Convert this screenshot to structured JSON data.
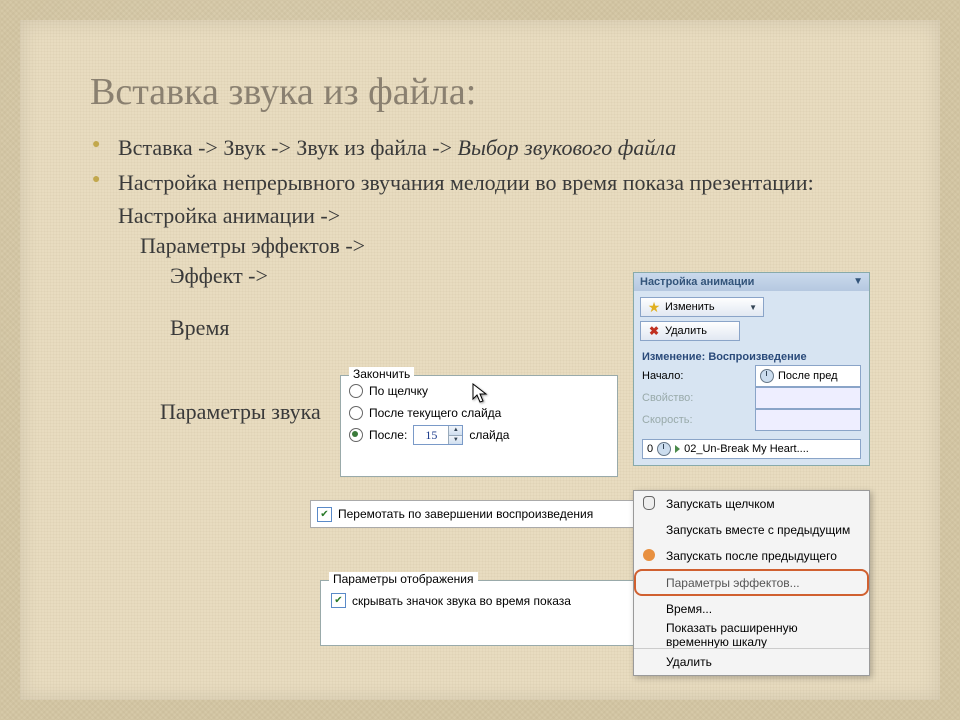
{
  "title": "Вставка звука из файла:",
  "bullets": {
    "b1_pre": "Вставка -> Звук -> Звук из файла -> ",
    "b1_em": "Выбор звукового файла",
    "b2": "Настройка непрерывного  звучания мелодии во время показа презентации:"
  },
  "sub": {
    "anim": "Настройка анимации ->",
    "params": "Параметры эффектов ->",
    "effect": "Эффект ->",
    "time": "Время",
    "sound": "Параметры звука"
  },
  "end_panel": {
    "legend": "Закончить",
    "opt1": "По щелчку",
    "opt2": "После текущего слайда",
    "opt3_before": "После:",
    "opt3_value": "15",
    "opt3_after": "слайда"
  },
  "rewind": {
    "label": "Перемотать по завершении воспроизведения"
  },
  "display": {
    "legend": "Параметры отображения",
    "label": "скрывать значок звука во время показа"
  },
  "anim_pane": {
    "header": "Настройка анимации",
    "change": "Изменить",
    "delete": "Удалить",
    "section": "Изменение: Воспроизведение",
    "start_label": "Начало:",
    "start_value": "После пред",
    "prop_label": "Свойство:",
    "speed_label": "Скорость:",
    "item_index": "0",
    "item_name": "02_Un-Break My Heart...."
  },
  "ctx": {
    "m1": "Запускать щелчком",
    "m2": "Запускать вместе с предыдущим",
    "m3": "Запускать после предыдущего",
    "m4": "Параметры эффектов...",
    "m5": "Время...",
    "m6": "Показать расширенную временную шкалу",
    "m7": "Удалить"
  }
}
